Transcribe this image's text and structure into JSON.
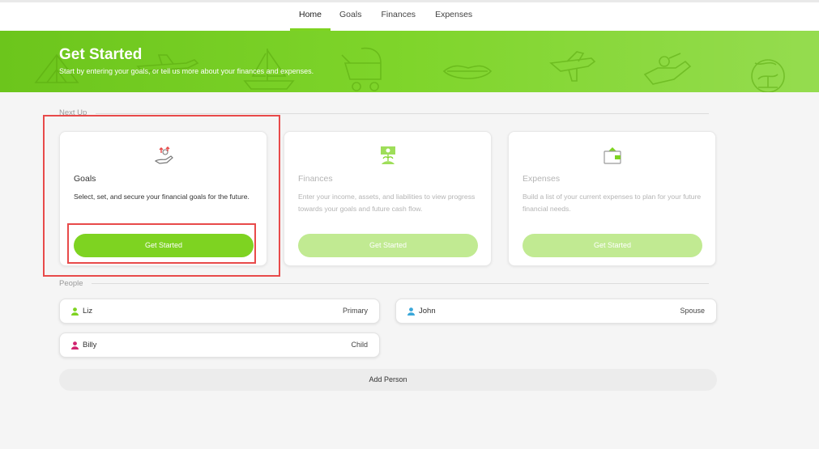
{
  "nav": {
    "tabs": [
      {
        "label": "Home",
        "active": true
      },
      {
        "label": "Goals"
      },
      {
        "label": "Finances"
      },
      {
        "label": "Expenses"
      }
    ]
  },
  "banner": {
    "title": "Get Started",
    "subtitle": "Start by entering your goals, or tell us more about your finances and expenses."
  },
  "next_up": {
    "label": "Next Up",
    "cards": [
      {
        "title": "Goals",
        "description": "Select, set, and secure your financial goals for the future.",
        "button": "Get Started",
        "icon": "hand-goals-icon",
        "enabled": true
      },
      {
        "title": "Finances",
        "description": "Enter your income, assets, and liabilities to view progress towards your goals and future cash flow.",
        "button": "Get Started",
        "icon": "money-plant-icon",
        "enabled": false
      },
      {
        "title": "Expenses",
        "description": "Build a list of your current expenses to plan for your future financial needs.",
        "button": "Get Started",
        "icon": "wallet-icon",
        "enabled": false
      }
    ]
  },
  "people": {
    "label": "People",
    "list": [
      {
        "name": "Liz",
        "role": "Primary",
        "color": "#7ed321"
      },
      {
        "name": "John",
        "role": "Spouse",
        "color": "#3aa7d9"
      },
      {
        "name": "Billy",
        "role": "Child",
        "color": "#d1236f"
      }
    ],
    "add_label": "Add Person"
  },
  "colors": {
    "accent": "#7ed321",
    "annotation": "#e84a4a"
  }
}
